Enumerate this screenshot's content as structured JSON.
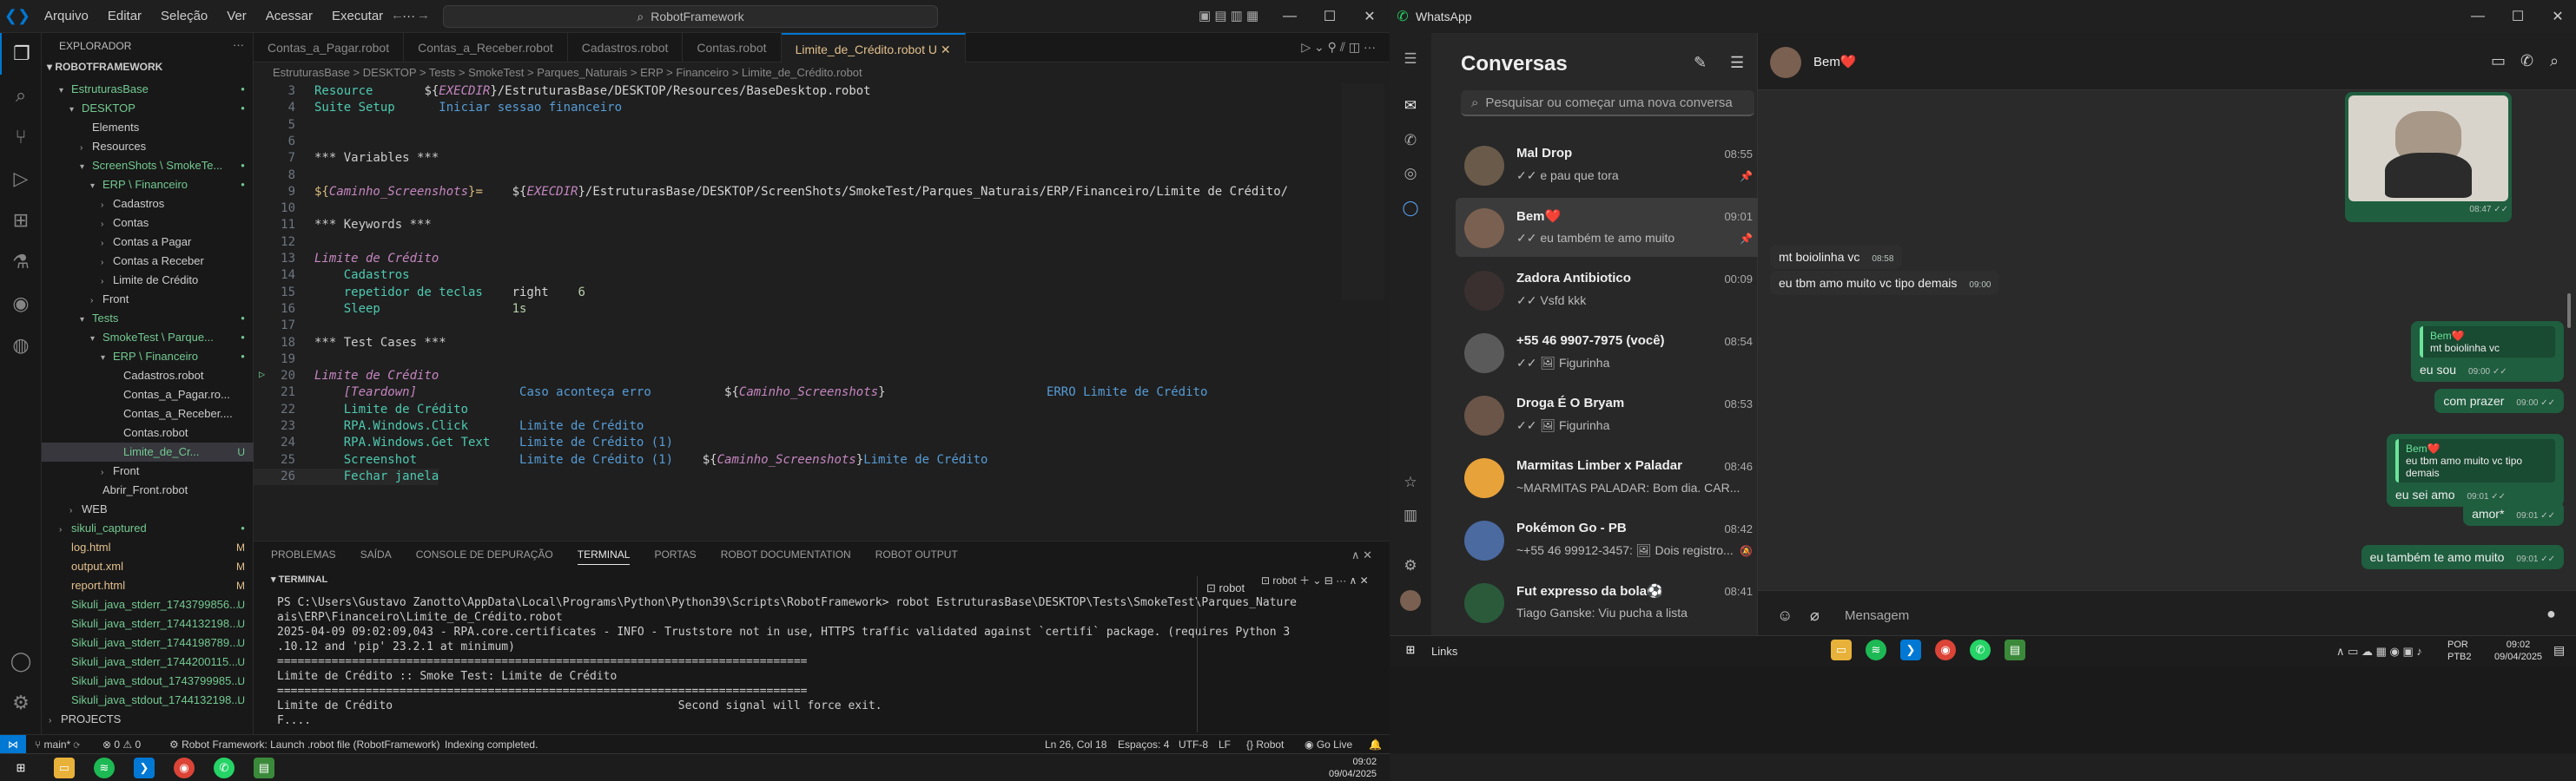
{
  "vscode": {
    "menu": [
      "Arquivo",
      "Editar",
      "Seleção",
      "Ver",
      "Acessar",
      "Executar"
    ],
    "search": "RobotFramework",
    "explorer_title": "EXPLORADOR",
    "root": "ROBOTFRAMEWORK",
    "tree": [
      {
        "label": "EstruturasBase",
        "indent": 1,
        "arrow": "v",
        "status": "dot"
      },
      {
        "label": "DESKTOP",
        "indent": 2,
        "arrow": "v",
        "status": "dot"
      },
      {
        "label": "Elements",
        "indent": 3,
        "arrow": "",
        "status": ""
      },
      {
        "label": "Resources",
        "indent": 3,
        "arrow": ">",
        "status": ""
      },
      {
        "label": "ScreenShots \\ SmokeTe...",
        "indent": 3,
        "arrow": "v",
        "status": "dot"
      },
      {
        "label": "ERP \\ Financeiro",
        "indent": 4,
        "arrow": "v",
        "status": "dot"
      },
      {
        "label": "Cadastros",
        "indent": 5,
        "arrow": ">",
        "status": ""
      },
      {
        "label": "Contas",
        "indent": 5,
        "arrow": ">",
        "status": ""
      },
      {
        "label": "Contas a Pagar",
        "indent": 5,
        "arrow": ">",
        "status": ""
      },
      {
        "label": "Contas a Receber",
        "indent": 5,
        "arrow": ">",
        "status": ""
      },
      {
        "label": "Limite de Crédito",
        "indent": 5,
        "arrow": ">",
        "status": ""
      },
      {
        "label": "Front",
        "indent": 4,
        "arrow": ">",
        "status": ""
      },
      {
        "label": "Tests",
        "indent": 3,
        "arrow": "v",
        "status": "dot"
      },
      {
        "label": "SmokeTest \\ Parque...",
        "indent": 4,
        "arrow": "v",
        "status": "dot"
      },
      {
        "label": "ERP \\ Financeiro",
        "indent": 5,
        "arrow": "v",
        "status": "dot"
      },
      {
        "label": "Cadastros.robot",
        "indent": 6,
        "arrow": "",
        "status": ""
      },
      {
        "label": "Contas_a_Pagar.ro...",
        "indent": 6,
        "arrow": "",
        "status": ""
      },
      {
        "label": "Contas_a_Receber....",
        "indent": 6,
        "arrow": "",
        "status": ""
      },
      {
        "label": "Contas.robot",
        "indent": 6,
        "arrow": "",
        "status": ""
      },
      {
        "label": "Limite_de_Cr...",
        "indent": 6,
        "arrow": "",
        "status": "U"
      },
      {
        "label": "Front",
        "indent": 5,
        "arrow": ">",
        "status": ""
      },
      {
        "label": "Abrir_Front.robot",
        "indent": 4,
        "arrow": "",
        "status": ""
      },
      {
        "label": "WEB",
        "indent": 2,
        "arrow": ">",
        "status": ""
      },
      {
        "label": "sikuli_captured",
        "indent": 1,
        "arrow": ">",
        "status": "dot"
      },
      {
        "label": "log.html",
        "indent": 1,
        "arrow": "",
        "status": "M"
      },
      {
        "label": "output.xml",
        "indent": 1,
        "arrow": "",
        "status": "M"
      },
      {
        "label": "report.html",
        "indent": 1,
        "arrow": "",
        "status": "M"
      },
      {
        "label": "Sikuli_java_stderr_1743799856...",
        "indent": 1,
        "arrow": "",
        "status": "U"
      },
      {
        "label": "Sikuli_java_stderr_1744132198...",
        "indent": 1,
        "arrow": "",
        "status": "U"
      },
      {
        "label": "Sikuli_java_stderr_1744198789...",
        "indent": 1,
        "arrow": "",
        "status": "U"
      },
      {
        "label": "Sikuli_java_stderr_1744200115...",
        "indent": 1,
        "arrow": "",
        "status": "U"
      },
      {
        "label": "Sikuli_java_stdout_1743799985...",
        "indent": 1,
        "arrow": "",
        "status": "U"
      },
      {
        "label": "Sikuli_java_stdout_1744132198...",
        "indent": 1,
        "arrow": "",
        "status": "U"
      },
      {
        "label": "PROJECTS",
        "indent": 0,
        "arrow": ">",
        "status": ""
      }
    ],
    "tabs": [
      "Contas_a_Pagar.robot",
      "Contas_a_Receber.robot",
      "Cadastros.robot",
      "Contas.robot",
      "Limite_de_Crédito.robot U"
    ],
    "breadcrumb": "EstruturasBase > DESKTOP > Tests > SmokeTest > Parques_Naturais > ERP > Financeiro > Limite_de_Crédito.robot",
    "code": [
      {
        "n": "3",
        "parts": [
          [
            "kwd",
            "Resource       "
          ],
          [
            "arg",
            "${"
          ],
          [
            "vi",
            "EXECDIR"
          ],
          [
            "arg",
            "}/EstruturasBase/DESKTOP/Resources/BaseDesktop.robot"
          ]
        ]
      },
      {
        "n": "4",
        "parts": [
          [
            "kwd",
            "Suite Setup      "
          ],
          [
            "set",
            "Iniciar sessao financeiro"
          ]
        ]
      },
      {
        "n": "5",
        "parts": []
      },
      {
        "n": "6",
        "parts": []
      },
      {
        "n": "7",
        "parts": [
          [
            "sec",
            "*** Variables ***"
          ]
        ]
      },
      {
        "n": "8",
        "parts": []
      },
      {
        "n": "9",
        "parts": [
          [
            "var",
            "${"
          ],
          [
            "vi",
            "Caminho_Screenshots"
          ],
          [
            "var",
            "}="
          ],
          [
            "arg",
            "    ${"
          ],
          [
            "vi",
            "EXECDIR"
          ],
          [
            "arg",
            "}/EstruturasBase/DESKTOP/ScreenShots/SmokeTest/Parques_Naturais/ERP/Financeiro/Limite de Crédito/"
          ]
        ]
      },
      {
        "n": "10",
        "parts": []
      },
      {
        "n": "11",
        "parts": [
          [
            "sec",
            "*** Keywords ***"
          ]
        ]
      },
      {
        "n": "12",
        "parts": []
      },
      {
        "n": "13",
        "parts": [
          [
            "tc",
            "Limite de Crédito"
          ]
        ]
      },
      {
        "n": "14",
        "parts": [
          [
            "kwd",
            "    Cadastros"
          ]
        ]
      },
      {
        "n": "15",
        "parts": [
          [
            "kwd",
            "    repetidor de teclas    "
          ],
          [
            "arg",
            "right    "
          ],
          [
            "num",
            "6"
          ]
        ]
      },
      {
        "n": "16",
        "parts": [
          [
            "kwd",
            "    Sleep                  "
          ],
          [
            "num",
            "1s"
          ]
        ]
      },
      {
        "n": "17",
        "parts": []
      },
      {
        "n": "18",
        "parts": [
          [
            "sec",
            "*** Test Cases ***"
          ]
        ]
      },
      {
        "n": "19",
        "parts": []
      },
      {
        "n": "20",
        "parts": [
          [
            "tc",
            "Limite de Crédito"
          ]
        ]
      },
      {
        "n": "21",
        "parts": [
          [
            "tc",
            "    [Teardown]"
          ],
          [
            "arg",
            "              "
          ],
          [
            "set",
            "Caso aconteça erro"
          ],
          [
            "arg",
            "          ${"
          ],
          [
            "vi",
            "Caminho_Screenshots"
          ],
          [
            "arg",
            "}                      "
          ],
          [
            "set",
            "ERRO Limite de Crédito"
          ]
        ]
      },
      {
        "n": "22",
        "parts": [
          [
            "kwd",
            "    Limite de Crédito"
          ]
        ]
      },
      {
        "n": "23",
        "parts": [
          [
            "kwd",
            "    RPA.Windows.Click       "
          ],
          [
            "set",
            "Limite de Crédito"
          ]
        ]
      },
      {
        "n": "24",
        "parts": [
          [
            "kwd",
            "    RPA.Windows.Get Text    "
          ],
          [
            "set",
            "Limite de Crédito (1)"
          ]
        ]
      },
      {
        "n": "25",
        "parts": [
          [
            "kwd",
            "    Screenshot              "
          ],
          [
            "set",
            "Limite de Crédito (1)    "
          ],
          [
            "arg",
            "${"
          ],
          [
            "vi",
            "Caminho_Screenshots"
          ],
          [
            "arg",
            "}"
          ],
          [
            "set",
            "Limite de Crédito"
          ]
        ]
      },
      {
        "n": "26",
        "parts": [
          [
            "kwd",
            "    Fechar janela"
          ]
        ]
      }
    ],
    "panel_tabs": [
      "PROBLEMAS",
      "SAÍDA",
      "CONSOLE DE DEPURAÇÃO",
      "TERMINAL",
      "PORTAS",
      "ROBOT DOCUMENTATION",
      "ROBOT OUTPUT"
    ],
    "terminal_title": "TERMINAL",
    "terminal_instance": "robot",
    "terminal_lines": [
      "PS C:\\Users\\Gustavo Zanotto\\AppData\\Local\\Programs\\Python\\Python39\\Scripts\\RobotFramework> robot EstruturasBase\\DESKTOP\\Tests\\SmokeTest\\Parques_Nature",
      "ais\\ERP\\Financeiro\\Limite_de_Crédito.robot",
      "2025-04-09 09:02:09,043 - RPA.core.certificates - INFO - Truststore not in use, HTTPS traffic validated against `certifi` package. (requires Python 3",
      ".10.12 and 'pip' 23.2.1 at minimum)",
      "==============================================================================",
      "Limite de Crédito :: Smoke Test: Limite de Crédito",
      "==============================================================================",
      "Limite de Crédito                                          Second signal will force exit.",
      "F...."
    ],
    "status": {
      "branch": "main*",
      "problems": "0 ⚠ 0",
      "robot": "Robot Framework: Launch .robot file (RobotFramework)",
      "indexing": "Indexing completed.",
      "pos": "Ln 26, Col 18",
      "spaces": "Espaços: 4",
      "enc": "UTF-8",
      "eol": "LF",
      "lang": "Robot",
      "live": "Go Live"
    },
    "clock": {
      "time": "09:02",
      "date": "09/04/2025"
    }
  },
  "whatsapp": {
    "app_title": "WhatsApp",
    "list_title": "Conversas",
    "search_placeholder": "Pesquisar ou começar uma nova conversa",
    "chats": [
      {
        "name": "Mal Drop",
        "time": "08:55",
        "preview": "✓✓ e pau que tora",
        "pinned": true,
        "color": "#6a5a4a"
      },
      {
        "name": "Bem❤️",
        "time": "09:01",
        "preview": "✓✓ eu também te amo muito",
        "pinned": true,
        "color": "#7a6050",
        "selected": true
      },
      {
        "name": "Zadora Antibiotico",
        "time": "00:09",
        "preview": "✓✓ Vsfd kkk",
        "pinned": false,
        "color": "#3a3030"
      },
      {
        "name": "+55 46 9907-7975 (você)",
        "time": "08:54",
        "preview": "✓✓ 🖼 Figurinha",
        "pinned": false,
        "color": "#5a5a5a"
      },
      {
        "name": "Droga É O Bryam",
        "time": "08:53",
        "preview": "✓✓ 🖼 Figurinha",
        "pinned": false,
        "color": "#6a5548"
      },
      {
        "name": "Marmitas Limber x Paladar",
        "time": "08:46",
        "preview": "~MARMITAS PALADAR: Bom dia.  CAR...",
        "pinned": false,
        "color": "#e8a23a"
      },
      {
        "name": "Pokémon Go - PB",
        "time": "08:42",
        "preview": "~+55 46 99912-3457: 🖼 Dois registro...",
        "pinned": false,
        "color": "#4a6aa0"
      },
      {
        "name": "Fut expresso da bola⚽",
        "time": "08:41",
        "preview": "Tiago Ganske: Viu pucha a lista",
        "pinned": false,
        "color": "#2a5a3a"
      }
    ],
    "contact": "Bem❤️",
    "messages": [
      {
        "dir": "in",
        "text": "mt boiolinha vc",
        "time": "08:58"
      },
      {
        "dir": "in",
        "text": "eu tbm amo muito vc tipo demais",
        "time": "09:00"
      },
      {
        "dir": "out",
        "quote_name": "Bem❤️",
        "quote": "mt boiolinha vc",
        "text": "eu sou",
        "time": "09:00"
      },
      {
        "dir": "out",
        "text": "com prazer",
        "time": "09:00"
      },
      {
        "dir": "out",
        "quote_name": "Bem❤️",
        "quote": "eu tbm amo muito vc tipo demais",
        "text": "eu sei amo",
        "time": "09:01"
      },
      {
        "dir": "out",
        "text": "amor*",
        "time": "09:01"
      },
      {
        "dir": "out",
        "text": "eu também te amo muito",
        "time": "09:01"
      }
    ],
    "sticker_time": "08:47",
    "sticker_caption": "mt boiolinha vc",
    "input_placeholder": "Mensagem"
  },
  "taskbar_right": {
    "label": "Links",
    "lang": "POR",
    "layout": "PTB2",
    "time": "09:02",
    "date": "09/04/2025"
  },
  "colors": {
    "accent": "#0078d4",
    "wa_green": "#1f5e3f",
    "wa_accent": "#6ce39b"
  }
}
